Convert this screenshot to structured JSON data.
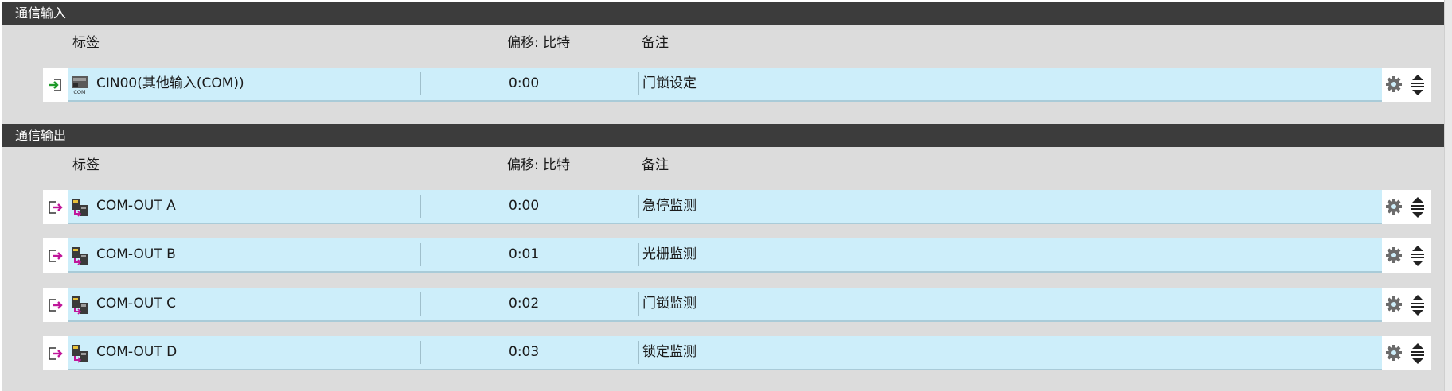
{
  "colors": {
    "header_bg": "#3c3c3c",
    "panel_bg": "#dcdcdc",
    "row_band": "#cdeefa",
    "input_arrow": "#1e9a2a",
    "output_arrow": "#c0169a"
  },
  "input_section": {
    "title": "通信输入",
    "columns": {
      "label": "标签",
      "offset": "偏移: 比特",
      "note": "备注"
    },
    "rows": [
      {
        "direction_icon": "input-arrow-icon",
        "type_icon": "com-device-icon",
        "label": "CIN00(其他输入(COM))",
        "offset": "0:00",
        "note": "门锁设定"
      }
    ]
  },
  "output_section": {
    "title": "通信输出",
    "columns": {
      "label": "标签",
      "offset": "偏移: 比特",
      "note": "备注"
    },
    "rows": [
      {
        "direction_icon": "output-arrow-icon",
        "type_icon": "com-out-module-icon",
        "label": "COM-OUT A",
        "offset": "0:00",
        "note": "急停监测"
      },
      {
        "direction_icon": "output-arrow-icon",
        "type_icon": "com-out-module-icon",
        "label": "COM-OUT B",
        "offset": "0:01",
        "note": "光栅监测"
      },
      {
        "direction_icon": "output-arrow-icon",
        "type_icon": "com-out-module-icon",
        "label": "COM-OUT C",
        "offset": "0:02",
        "note": "门锁监测"
      },
      {
        "direction_icon": "output-arrow-icon",
        "type_icon": "com-out-module-icon",
        "label": "COM-OUT D",
        "offset": "0:03",
        "note": "锁定监测"
      }
    ]
  },
  "row_actions": {
    "settings_icon": "gear-icon",
    "reorder_icon": "reorder-icon"
  }
}
